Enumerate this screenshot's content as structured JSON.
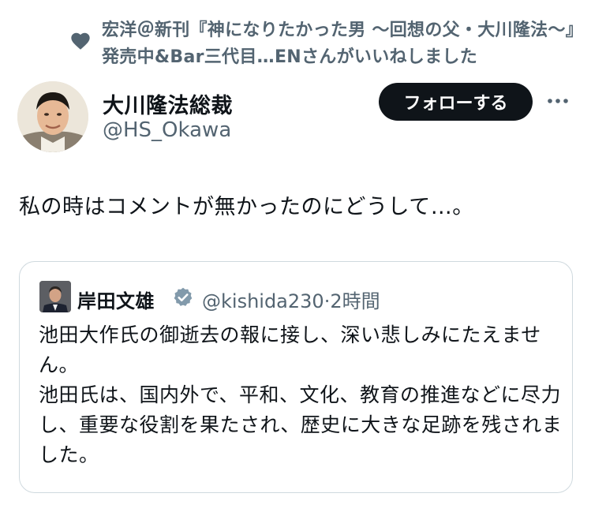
{
  "liked_by": {
    "icon": "heart-icon",
    "text": "宏洋＠新刊『神になりたかった男 〜回想の父・大川隆法〜』発売中&Bar三代目…ENさんがいいねしました"
  },
  "author": {
    "name": "大川隆法総裁",
    "handle": "@HS_Okawa",
    "follow_label": "フォローする"
  },
  "tweet": {
    "text": "私の時はコメントが無かったのにどうして…。"
  },
  "quoted": {
    "name": "岸田文雄",
    "handle": "@kishida230",
    "separator": "·",
    "time": "2時間",
    "paragraph1": "池田大作氏の御逝去の報に接し、深い悲しみにたえません。",
    "paragraph2": "池田氏は、国内外で、平和、文化、教育の推進などに尽力し、重要な役割を果たされ、歴史に大きな足跡を残されました。"
  },
  "colors": {
    "text_primary": "#0f1419",
    "text_secondary": "#536471",
    "border": "#cfd9de",
    "verified": "#829aab",
    "button_bg": "#0f1419"
  }
}
